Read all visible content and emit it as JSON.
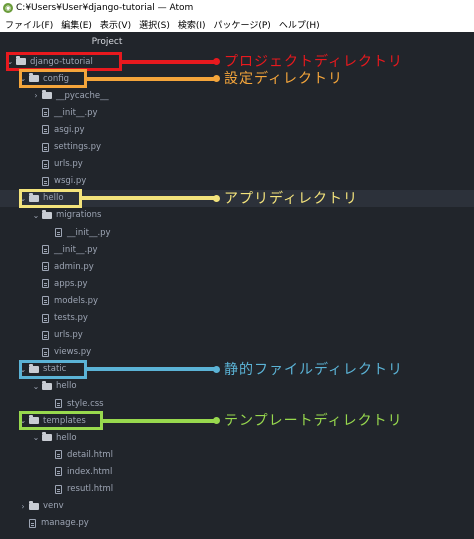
{
  "window": {
    "title": "C:¥Users¥User¥django-tutorial — Atom"
  },
  "menu": [
    "ファイル(F)",
    "編集(E)",
    "表示(V)",
    "選択(S)",
    "検索(I)",
    "パッケージ(P)",
    "ヘルプ(H)"
  ],
  "panel": {
    "title": "Project"
  },
  "tree": [
    {
      "label": "django-tutorial",
      "kind": "folder",
      "depth": 0,
      "expanded": true
    },
    {
      "label": "config",
      "kind": "folder",
      "depth": 1,
      "expanded": true
    },
    {
      "label": "__pycache__",
      "kind": "folder",
      "depth": 2,
      "expanded": false
    },
    {
      "label": "__init__.py",
      "kind": "file",
      "depth": 2
    },
    {
      "label": "asgi.py",
      "kind": "file",
      "depth": 2
    },
    {
      "label": "settings.py",
      "kind": "file",
      "depth": 2
    },
    {
      "label": "urls.py",
      "kind": "file",
      "depth": 2
    },
    {
      "label": "wsgi.py",
      "kind": "file",
      "depth": 2
    },
    {
      "label": "hello",
      "kind": "folder",
      "depth": 1,
      "expanded": true,
      "selected": true
    },
    {
      "label": "migrations",
      "kind": "folder",
      "depth": 2,
      "expanded": true
    },
    {
      "label": "__init__.py",
      "kind": "file",
      "depth": 3
    },
    {
      "label": "__init__.py",
      "kind": "file",
      "depth": 2
    },
    {
      "label": "admin.py",
      "kind": "file",
      "depth": 2
    },
    {
      "label": "apps.py",
      "kind": "file",
      "depth": 2
    },
    {
      "label": "models.py",
      "kind": "file",
      "depth": 2
    },
    {
      "label": "tests.py",
      "kind": "file",
      "depth": 2
    },
    {
      "label": "urls.py",
      "kind": "file",
      "depth": 2
    },
    {
      "label": "views.py",
      "kind": "file",
      "depth": 2
    },
    {
      "label": "static",
      "kind": "folder",
      "depth": 1,
      "expanded": true
    },
    {
      "label": "hello",
      "kind": "folder",
      "depth": 2,
      "expanded": true
    },
    {
      "label": "style.css",
      "kind": "file",
      "depth": 3
    },
    {
      "label": "templates",
      "kind": "folder",
      "depth": 1,
      "expanded": true
    },
    {
      "label": "hello",
      "kind": "folder",
      "depth": 2,
      "expanded": true
    },
    {
      "label": "detail.html",
      "kind": "file",
      "depth": 3
    },
    {
      "label": "index.html",
      "kind": "file",
      "depth": 3
    },
    {
      "label": "resutl.html",
      "kind": "file",
      "depth": 3
    },
    {
      "label": "venv",
      "kind": "folder",
      "depth": 1,
      "expanded": false
    },
    {
      "label": "manage.py",
      "kind": "file",
      "depth": 1
    }
  ],
  "annotations": [
    {
      "row": 0,
      "text": "プロジェクトディレクトリ",
      "color": "#e8191e"
    },
    {
      "row": 1,
      "text": "設定ディレクトリ",
      "color": "#f4a53b"
    },
    {
      "row": 8,
      "text": "アプリディレクトリ",
      "color": "#f3e37c"
    },
    {
      "row": 18,
      "text": "静的ファイルディレクトリ",
      "color": "#5bb3d6"
    },
    {
      "row": 21,
      "text": "テンプレートディレクトリ",
      "color": "#98d94e"
    }
  ]
}
